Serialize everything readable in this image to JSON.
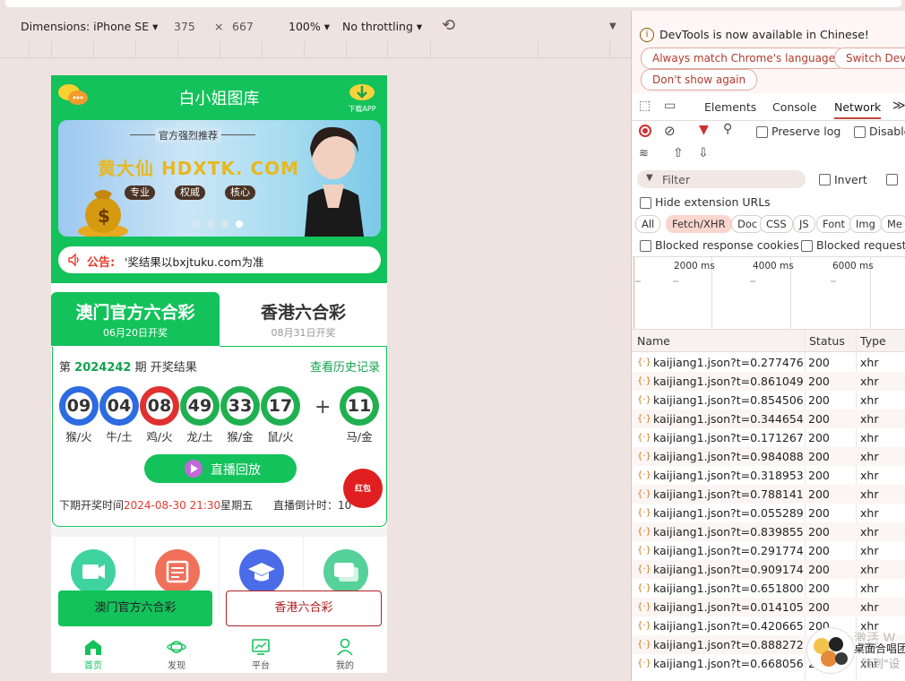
{
  "device_toolbar": {
    "dimensions_label": "Dimensions: iPhone SE",
    "width": "375",
    "times": "×",
    "height": "667",
    "zoom": "100%",
    "throttling": "No throttling"
  },
  "phone": {
    "site_title": "白小姐图库",
    "download_label": "下载APP",
    "banner": {
      "recommend": "官方强烈推荐",
      "name": "黄大仙 HDXTK. COM",
      "tags": [
        "专业",
        "权威",
        "核心"
      ]
    },
    "notice": {
      "label": "公告:",
      "text": "'奖结果以bxjtuku.com为准"
    },
    "tabs": [
      {
        "name": "澳门官方六合彩",
        "date": "06月20日开奖",
        "active": true
      },
      {
        "name": "香港六合彩",
        "date": "08月31日开奖",
        "active": false
      }
    ],
    "result": {
      "issue_prefix": "第",
      "issue_number": "2024242",
      "issue_suffix": "期 开奖结果",
      "history_link": "查看历史记录",
      "plus": "+",
      "balls": [
        {
          "num": "09",
          "zodiac": "猴/火",
          "color": "#2d6be0"
        },
        {
          "num": "04",
          "zodiac": "牛/土",
          "color": "#2d6be0"
        },
        {
          "num": "08",
          "zodiac": "鸡/火",
          "color": "#e03030"
        },
        {
          "num": "49",
          "zodiac": "龙/土",
          "color": "#20b050"
        },
        {
          "num": "33",
          "zodiac": "猴/金",
          "color": "#20b050"
        },
        {
          "num": "17",
          "zodiac": "鼠/火",
          "color": "#20b050"
        }
      ],
      "special": {
        "num": "11",
        "zodiac": "马/金",
        "color": "#20b050"
      },
      "live_label": "直播回放",
      "next_prefix": "下期开奖时间",
      "next_time": "2024-08-30 21:30",
      "next_weekday": "星期五",
      "countdown": "直播倒计时：10",
      "redpacket": "红包"
    },
    "grid_colors": [
      "#3fd3a0",
      "#f0705a",
      "#4a6ce8",
      "#55d199"
    ],
    "bottom_buttons": [
      "澳门官方六合彩",
      "香港六合彩"
    ],
    "nav": [
      {
        "label": "首页",
        "active": true
      },
      {
        "label": "发现",
        "active": false
      },
      {
        "label": "平台",
        "active": false
      },
      {
        "label": "我的",
        "active": false
      }
    ]
  },
  "devtools": {
    "info_message": "DevTools is now available in Chinese!",
    "info_buttons": [
      "Always match Chrome's language",
      "Switch DevT",
      "Don't show again"
    ],
    "tabs": [
      "Elements",
      "Console",
      "Network"
    ],
    "active_tab": "Network",
    "preserve_log": "Preserve log",
    "disable_cache": "Disable",
    "filter_placeholder": "Filter",
    "invert": "Invert",
    "hide_ext_urls": "Hide extension URLs",
    "chips": [
      "All",
      "Fetch/XHR",
      "Doc",
      "CSS",
      "JS",
      "Font",
      "Img",
      "Me"
    ],
    "selected_chip": "Fetch/XHR",
    "blocked_cookies": "Blocked response cookies",
    "blocked_requests": "Blocked requests",
    "timeline_ticks": [
      "2000 ms",
      "4000 ms",
      "6000 ms"
    ],
    "columns": [
      "Name",
      "Status",
      "Type"
    ],
    "requests": [
      {
        "name": "kaijiang1.json?t=0.277476...",
        "status": "200",
        "type": "xhr"
      },
      {
        "name": "kaijiang1.json?t=0.861049...",
        "status": "200",
        "type": "xhr"
      },
      {
        "name": "kaijiang1.json?t=0.854506...",
        "status": "200",
        "type": "xhr"
      },
      {
        "name": "kaijiang1.json?t=0.344654...",
        "status": "200",
        "type": "xhr"
      },
      {
        "name": "kaijiang1.json?t=0.171267...",
        "status": "200",
        "type": "xhr"
      },
      {
        "name": "kaijiang1.json?t=0.984088...",
        "status": "200",
        "type": "xhr"
      },
      {
        "name": "kaijiang1.json?t=0.318953...",
        "status": "200",
        "type": "xhr"
      },
      {
        "name": "kaijiang1.json?t=0.788141...",
        "status": "200",
        "type": "xhr"
      },
      {
        "name": "kaijiang1.json?t=0.055289...",
        "status": "200",
        "type": "xhr"
      },
      {
        "name": "kaijiang1.json?t=0.839855...",
        "status": "200",
        "type": "xhr"
      },
      {
        "name": "kaijiang1.json?t=0.291774...",
        "status": "200",
        "type": "xhr"
      },
      {
        "name": "kaijiang1.json?t=0.909174...",
        "status": "200",
        "type": "xhr"
      },
      {
        "name": "kaijiang1.json?t=0.651800...",
        "status": "200",
        "type": "xhr"
      },
      {
        "name": "kaijiang1.json?t=0.014105...",
        "status": "200",
        "type": "xhr"
      },
      {
        "name": "kaijiang1.json?t=0.420665...",
        "status": "200",
        "type": "xhr"
      },
      {
        "name": "kaijiang1.json?t=0.888272...",
        "status": "200",
        "type": "xhr"
      },
      {
        "name": "kaijiang1.json?t=0.668056...",
        "status": "200",
        "type": "xhr"
      }
    ],
    "overlay_text_1": "激活 W",
    "overlay_text_2": "转到\"设",
    "overlay_text_3": "桌面合唱团"
  }
}
